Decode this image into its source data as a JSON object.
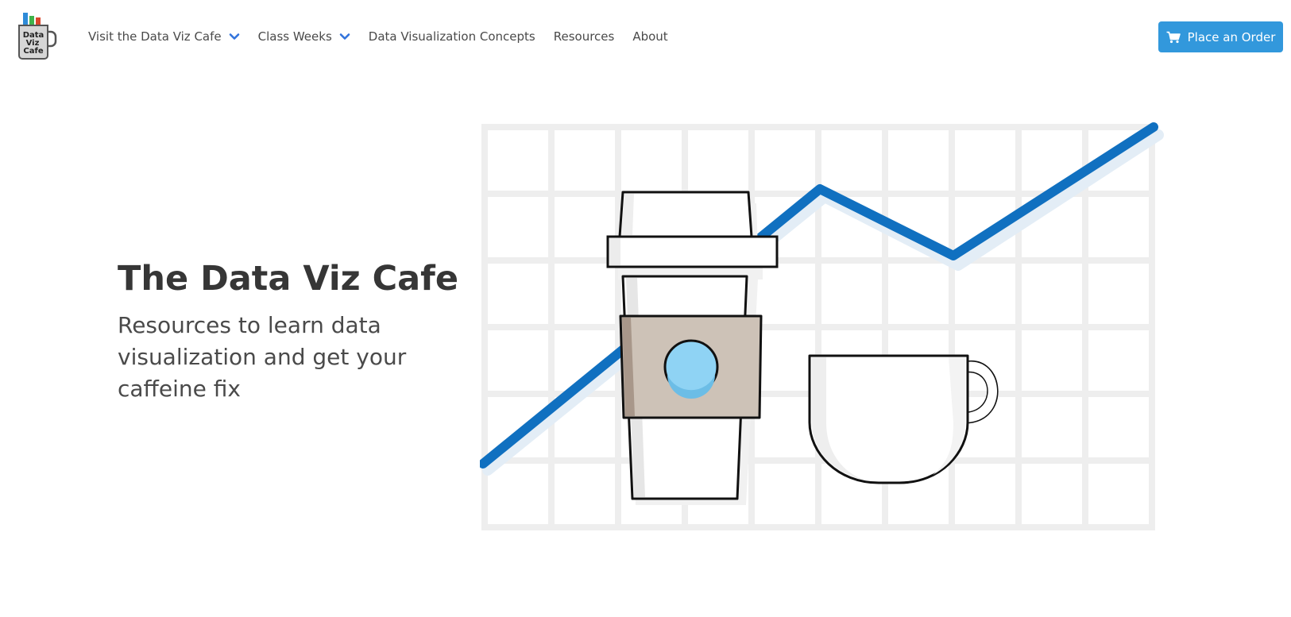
{
  "logo": {
    "line1": "Data",
    "line2": "Viz",
    "line3": "Cafe",
    "bar_colors": [
      "#2e8bd8",
      "#3fb24a",
      "#d9462b"
    ]
  },
  "nav": {
    "items": [
      {
        "label": "Visit the Data Viz Cafe",
        "dropdown": true
      },
      {
        "label": "Class Weeks",
        "dropdown": true
      },
      {
        "label": "Data Visualization Concepts",
        "dropdown": false
      },
      {
        "label": "Resources",
        "dropdown": false
      },
      {
        "label": "About",
        "dropdown": false
      }
    ],
    "chevron_icon": "chevron-down-icon",
    "chevron_color": "#3273dc"
  },
  "order_button": {
    "label": "Place an Order",
    "icon": "shopping-cart-icon",
    "color": "#3298dc"
  },
  "hero": {
    "title": "The Data Viz Cafe",
    "subtitle": "Resources to learn data visualization and get your caffeine fix"
  },
  "illustration": {
    "description_icon": "coffee-chart-illustration",
    "line_color": "#1070c0",
    "grid_color": "#eeeeee",
    "sleeve_color": "#cdc2b7",
    "logo_dot_color": "#8fd3f4"
  }
}
